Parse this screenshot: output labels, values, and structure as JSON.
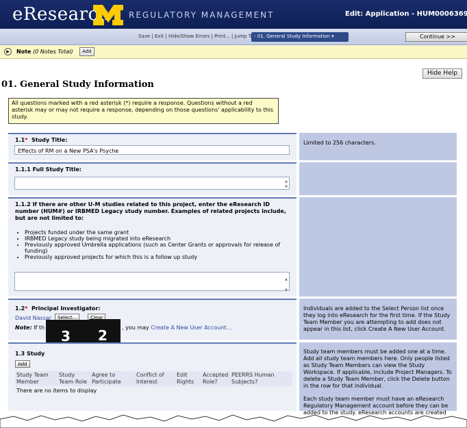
{
  "header": {
    "app_name": "eResearch",
    "module": "REGULATORY MANAGEMENT",
    "edit_title": "Edit: Application - HUM0006369"
  },
  "toolbar": {
    "links": "Save | Exit | Hide/Show Errors | Print... | Jump To:",
    "jump_value": "- 01. General Study Information ▾",
    "continue_label": "Continue >>"
  },
  "notes": {
    "label": "Note",
    "count": "(0 Notes Total)",
    "add_label": "Add"
  },
  "hide_help_label": "Hide Help",
  "page_title": "01. General Study Information",
  "info_text": "All questions marked with a red asterisk (*) require a response. Questions without a red asterisk may or may not require a response, depending on those questions' applicability to this study.",
  "q1_1": {
    "number": "1.1",
    "star": "*",
    "label": "Study Title:",
    "value": "Effects of RM on a New PSA's Psyche",
    "help": "Limited to 256 characters."
  },
  "q1_1_1": {
    "label": "1.1.1  Full Study Title:"
  },
  "q1_1_2": {
    "label": "1.1.2  If there are other U-M studies related to this project, enter the eResearch ID number (HUM#) or IRBMED Legacy study number. Examples of related projects include, but are not limited to:",
    "bullets": [
      "Projects funded under the same grant",
      "IRBMED Legacy study being migrated into eResearch",
      "Previously approved Umbrella applications (such as Center Grants or approvals for release of funding)",
      "Previously approved projects for which this is a follow up study"
    ]
  },
  "q1_2": {
    "number": "1.2",
    "star": "*",
    "label": "Principal Investigator:",
    "pi_name": "David Nassar",
    "select_label": "Select...",
    "clear_label": "Clear",
    "note_prefix": "Note:",
    "note_start": "If th",
    "note_mid": ", you may",
    "create_link": "Create A New User Account...",
    "help": "Individuals are added to the Select Person list once they log into eResearch for the first time. If the Study Team Member you are attempting to add does not appear in this list, click Create A New User Account."
  },
  "overlays": [
    "3",
    "2"
  ],
  "q1_3": {
    "label": "1.3  Study",
    "add_label": "Add",
    "columns": [
      "Study Team Member",
      "Study Team Role",
      "Agree to Participate",
      "Conflict of Interest",
      "Edit Rights",
      "Accepted Role?",
      "PEERRS Human Subjects?"
    ],
    "empty_text": "There are no items to display",
    "help": "Study team members must be added one at a time. Add all study team members here. Only people listed as Study Team Members can view the Study Workspace. If applicable, include Project Managers. To delete a Study Team Member, click the Delete button in the row for that individual.",
    "help2": "Each study team member must have an eResearch Regulatory Management account before they can be added to the study. eResearch accounts are created when"
  },
  "colors": {
    "header_bg": "#1a2d6b",
    "maize": "#ffcb05",
    "help_bg": "#bfc8e3",
    "panel_border": "#5f79b7",
    "info_bg": "#fdfcc8"
  }
}
